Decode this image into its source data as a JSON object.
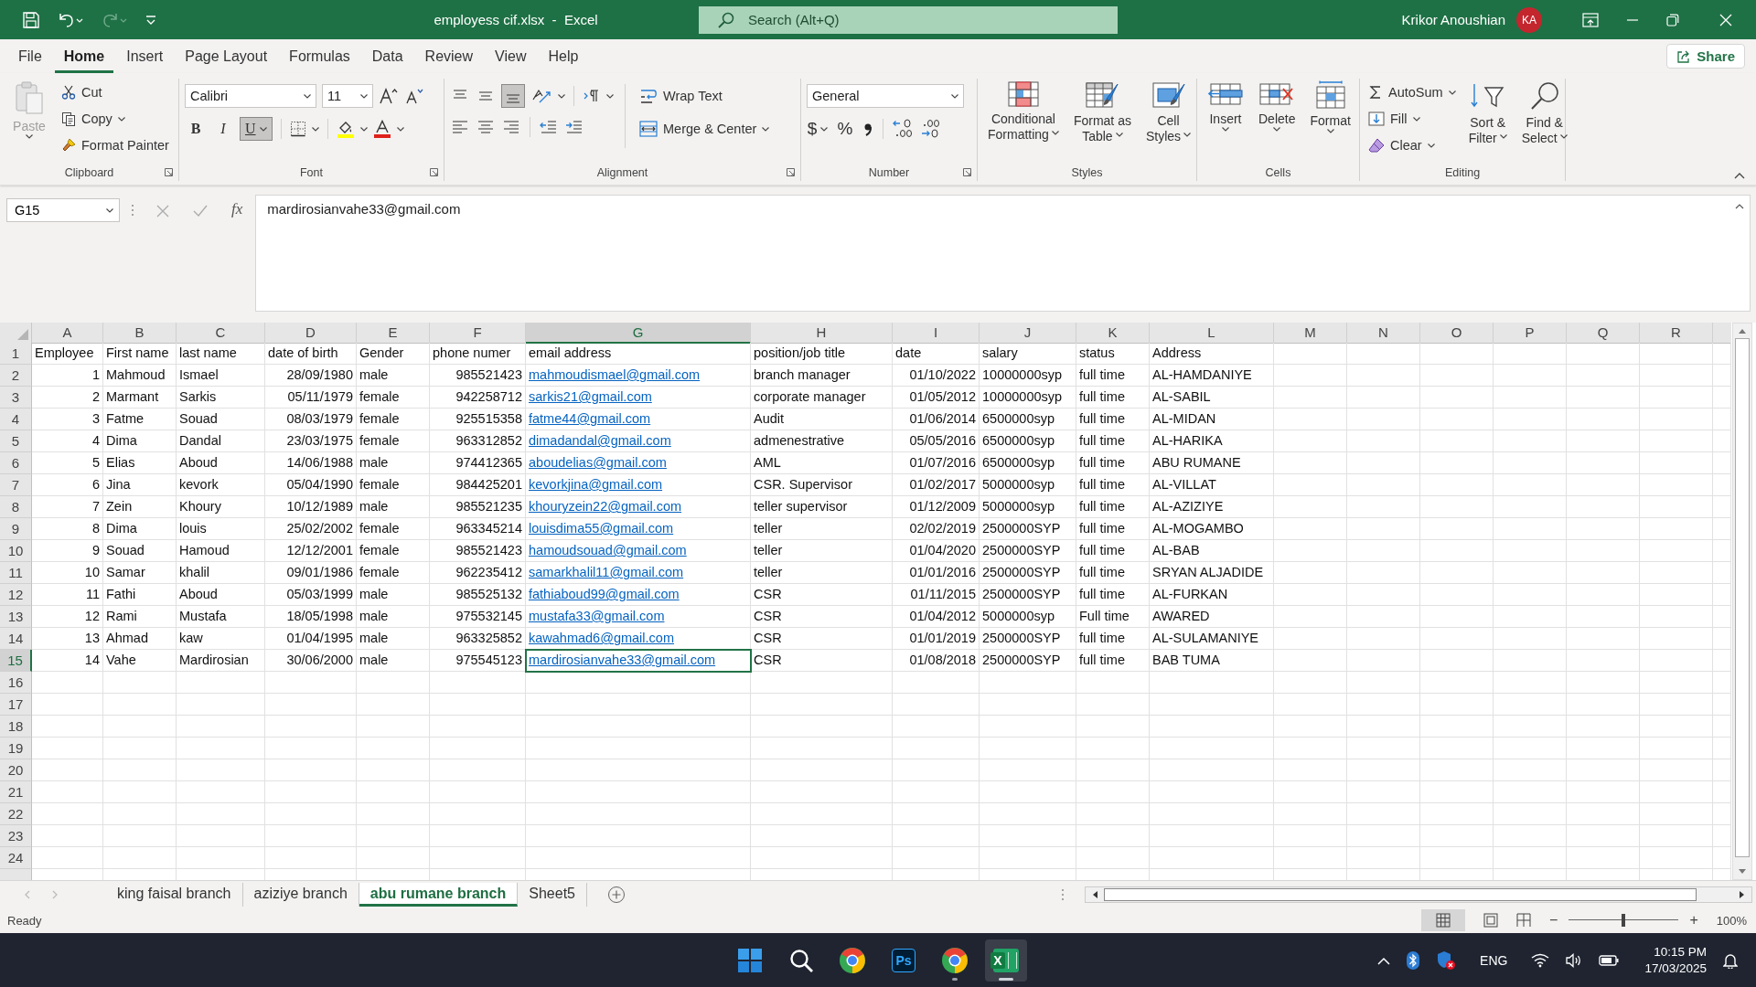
{
  "title_bar": {
    "file_title": "employess cif.xlsx  -  Excel",
    "search_placeholder": "Search (Alt+Q)",
    "user_name": "Krikor Anoushian",
    "user_initials": "KA"
  },
  "menu_tabs": [
    {
      "label": "File",
      "selected": false
    },
    {
      "label": "Home",
      "selected": true
    },
    {
      "label": "Insert",
      "selected": false
    },
    {
      "label": "Page Layout",
      "selected": false
    },
    {
      "label": "Formulas",
      "selected": false
    },
    {
      "label": "Data",
      "selected": false
    },
    {
      "label": "Review",
      "selected": false
    },
    {
      "label": "View",
      "selected": false
    },
    {
      "label": "Help",
      "selected": false
    }
  ],
  "share": "Share",
  "ribbon": {
    "clipboard": {
      "label": "Clipboard",
      "paste": "Paste",
      "cut": "Cut",
      "copy": "Copy",
      "format_painter": "Format Painter"
    },
    "font": {
      "label": "Font",
      "font_name": "Calibri",
      "font_size": "11",
      "bold": "B",
      "italic": "I",
      "underline": "U",
      "underline_on": true
    },
    "alignment": {
      "label": "Alignment",
      "wrap_text": "Wrap Text",
      "merge_center": "Merge & Center",
      "bottom_align_on": true
    },
    "number": {
      "label": "Number",
      "format": "General",
      "currency": "$",
      "percent": "%"
    },
    "styles": {
      "label": "Styles",
      "conditional_formatting": [
        "Conditional",
        "Formatting"
      ],
      "format_as_table": [
        "Format as",
        "Table"
      ],
      "cell_styles": [
        "Cell",
        "Styles"
      ]
    },
    "cells": {
      "label": "Cells",
      "insert": "Insert",
      "delete": "Delete",
      "format": "Format"
    },
    "editing": {
      "label": "Editing",
      "autosum": "AutoSum",
      "fill": "Fill",
      "clear": "Clear",
      "sort_filter": [
        "Sort &",
        "Filter"
      ],
      "find_select": [
        "Find &",
        "Select"
      ]
    }
  },
  "formula_bar": {
    "name_box": "G15",
    "function_label": "fx",
    "formula": "mardirosianvahe33@gmail.com"
  },
  "sheet": {
    "columns": [
      {
        "letter": "A",
        "selected": false,
        "kind": "number"
      },
      {
        "letter": "B",
        "selected": false,
        "kind": "text"
      },
      {
        "letter": "C",
        "selected": false,
        "kind": "text"
      },
      {
        "letter": "D",
        "selected": false,
        "kind": "number"
      },
      {
        "letter": "E",
        "selected": false,
        "kind": "text"
      },
      {
        "letter": "F",
        "selected": false,
        "kind": "number"
      },
      {
        "letter": "G",
        "selected": true,
        "kind": "link"
      },
      {
        "letter": "H",
        "selected": false,
        "kind": "text"
      },
      {
        "letter": "I",
        "selected": false,
        "kind": "number"
      },
      {
        "letter": "J",
        "selected": false,
        "kind": "text"
      },
      {
        "letter": "K",
        "selected": false,
        "kind": "text"
      },
      {
        "letter": "L",
        "selected": false,
        "kind": "text"
      },
      {
        "letter": "M",
        "selected": false
      },
      {
        "letter": "N",
        "selected": false
      },
      {
        "letter": "O",
        "selected": false
      },
      {
        "letter": "P",
        "selected": false
      },
      {
        "letter": "Q",
        "selected": false
      },
      {
        "letter": "R",
        "selected": false
      }
    ],
    "rows": [
      {
        "number": "1",
        "selected": false,
        "kind": "heading",
        "cells": [
          "Employee",
          "First name",
          "last name",
          "date of birth",
          "Gender",
          "phone numer",
          "email address",
          "position/job title",
          "date",
          "salary",
          "status",
          "Address"
        ]
      },
      {
        "number": "2",
        "selected": false,
        "kind": "data",
        "cells": [
          "1",
          "Mahmoud",
          "Ismael",
          "28/09/1980",
          "male",
          "985521423",
          "mahmoudismael@gmail.com",
          "branch manager",
          "01/10/2022",
          "10000000syp",
          "full time",
          "AL-HAMDANIYE"
        ]
      },
      {
        "number": "3",
        "selected": false,
        "kind": "data",
        "cells": [
          "2",
          "Marmant",
          "Sarkis",
          "05/11/1979",
          "female",
          "942258712",
          "sarkis21@gmail.com",
          "corporate manager",
          "01/05/2012",
          "10000000syp",
          "full time",
          "AL-SABIL"
        ]
      },
      {
        "number": "4",
        "selected": false,
        "kind": "data",
        "cells": [
          "3",
          "Fatme",
          "Souad",
          "08/03/1979",
          "female",
          "925515358",
          "fatme44@gmail.com",
          "Audit",
          "01/06/2014",
          "6500000syp",
          "full time",
          "AL-MIDAN"
        ]
      },
      {
        "number": "5",
        "selected": false,
        "kind": "data",
        "cells": [
          "4",
          "Dima",
          "Dandal",
          "23/03/1975",
          "female",
          "963312852",
          "dimadandal@gmail.com",
          "admenestrative",
          "05/05/2016",
          "6500000syp",
          "full time",
          "AL-HARIKA"
        ]
      },
      {
        "number": "6",
        "selected": false,
        "kind": "data",
        "cells": [
          "5",
          "Elias",
          "Aboud",
          "14/06/1988",
          "male",
          "974412365",
          "aboudelias@gmail.com",
          "AML",
          "01/07/2016",
          "6500000syp",
          "full time",
          "ABU RUMANE"
        ]
      },
      {
        "number": "7",
        "selected": false,
        "kind": "data",
        "cells": [
          "6",
          "Jina",
          "kevork",
          "05/04/1990",
          "female",
          "984425201",
          "kevorkjina@gmail.com",
          "CSR. Supervisor",
          "01/02/2017",
          "5000000syp",
          "full time",
          "AL-VILLAT"
        ]
      },
      {
        "number": "8",
        "selected": false,
        "kind": "data",
        "cells": [
          "7",
          "Zein",
          "Khoury",
          "10/12/1989",
          "male",
          "985521235",
          "khouryzein22@gmail.com",
          "teller supervisor",
          "01/12/2009",
          "5000000syp",
          "full time",
          "AL-AZIZIYE"
        ]
      },
      {
        "number": "9",
        "selected": false,
        "kind": "data",
        "cells": [
          "8",
          "Dima",
          "louis",
          "25/02/2002",
          "female",
          "963345214",
          "louisdima55@gmail.com",
          "teller",
          "02/02/2019",
          "2500000SYP",
          "full time",
          "AL-MOGAMBO"
        ]
      },
      {
        "number": "10",
        "selected": false,
        "kind": "data",
        "cells": [
          "9",
          "Souad",
          "Hamoud",
          "12/12/2001",
          "female",
          "985521423",
          "hamoudsouad@gmail.com",
          "teller",
          "01/04/2020",
          "2500000SYP",
          "full time",
          "AL-BAB"
        ]
      },
      {
        "number": "11",
        "selected": false,
        "kind": "data",
        "cells": [
          "10",
          "Samar",
          "khalil",
          "09/01/1986",
          "female",
          "962235412",
          "samarkhalil11@gmail.com",
          "teller",
          "01/01/2016",
          "2500000SYP",
          "full time",
          "SRYAN ALJADIDE"
        ]
      },
      {
        "number": "12",
        "selected": false,
        "kind": "data",
        "cells": [
          "11",
          "Fathi",
          "Aboud",
          "05/03/1999",
          "male",
          "985525132",
          "fathiaboud99@gmail.com",
          "CSR",
          "01/11/2015",
          "2500000SYP",
          "full time",
          "AL-FURKAN"
        ]
      },
      {
        "number": "13",
        "selected": false,
        "kind": "data",
        "cells": [
          "12",
          "Rami",
          "Mustafa",
          "18/05/1998",
          "male",
          "975532145",
          "mustafa33@gmail.com",
          "CSR",
          "01/04/2012",
          "5000000syp",
          "Full time",
          "AWARED"
        ]
      },
      {
        "number": "14",
        "selected": false,
        "kind": "data",
        "cells": [
          "13",
          "Ahmad",
          "kaw",
          "01/04/1995",
          "male",
          "963325852",
          "kawahmad6@gmail.com",
          "CSR",
          "01/01/2019",
          "2500000SYP",
          "full time",
          "AL-SULAMANIYE"
        ]
      },
      {
        "number": "15",
        "selected": true,
        "kind": "data",
        "cells": [
          "14",
          "Vahe",
          "Mardirosian",
          "30/06/2000",
          "male",
          "975545123",
          "mardirosianvahe33@gmail.com",
          "CSR",
          "01/08/2018",
          "2500000SYP",
          "full time",
          "BAB TUMA"
        ]
      },
      {
        "number": "16",
        "selected": false
      },
      {
        "number": "17",
        "selected": false
      },
      {
        "number": "18",
        "selected": false
      },
      {
        "number": "19",
        "selected": false
      },
      {
        "number": "20",
        "selected": false
      },
      {
        "number": "21",
        "selected": false
      },
      {
        "number": "22",
        "selected": false
      },
      {
        "number": "23",
        "selected": false
      },
      {
        "number": "24",
        "selected": false
      }
    ]
  },
  "sheet_tabs": [
    {
      "label": "king faisal branch",
      "selected": false
    },
    {
      "label": "aziziye branch",
      "selected": false
    },
    {
      "label": "abu rumane branch",
      "selected": true
    },
    {
      "label": "Sheet5",
      "selected": false
    }
  ],
  "status_bar": {
    "status": "Ready",
    "zoom_out": "−",
    "zoom_in": "+",
    "zoom_slider": {
      "level": 0.5
    },
    "zoom": "100%"
  },
  "taskbar": {
    "apps": [
      {
        "kind": "start"
      },
      {
        "kind": "search"
      },
      {
        "kind": "chrome",
        "running": false
      },
      {
        "kind": "photoshop",
        "label": "Ps",
        "running": false
      },
      {
        "kind": "chrome",
        "running": true
      },
      {
        "kind": "excel",
        "label": "X",
        "running": true,
        "active": true
      }
    ],
    "language": "ENG",
    "time": "10:15 PM",
    "date": "17/03/2025"
  }
}
